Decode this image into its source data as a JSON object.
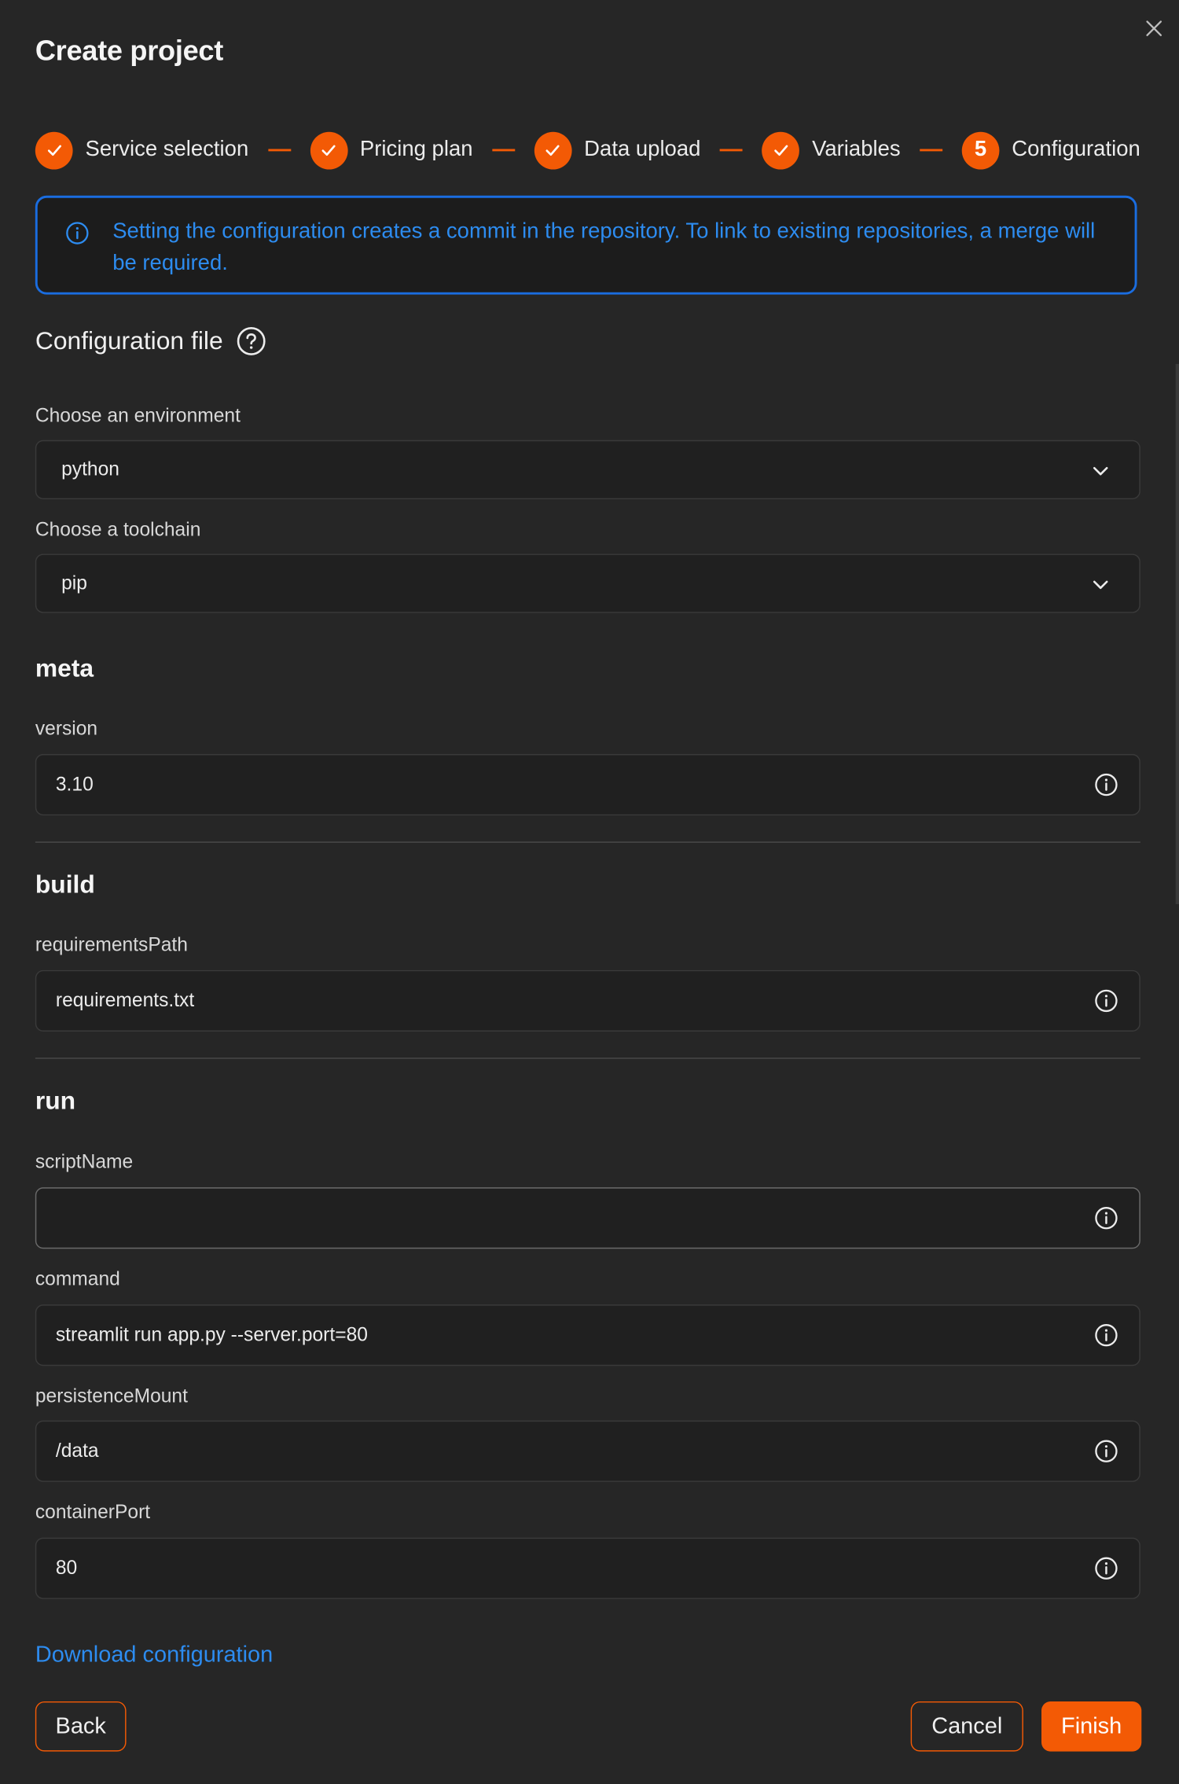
{
  "dialog": {
    "title": "Create project"
  },
  "steps": [
    {
      "label": "Service selection",
      "state": "done"
    },
    {
      "label": "Pricing plan",
      "state": "done"
    },
    {
      "label": "Data upload",
      "state": "done"
    },
    {
      "label": "Variables",
      "state": "done"
    },
    {
      "label": "Configuration",
      "state": "current",
      "number": "5"
    }
  ],
  "info": {
    "text": "Setting the configuration creates a commit in the repository. To link to existing repositories, a merge will be required."
  },
  "config_file": {
    "title": "Configuration file",
    "environment_label": "Choose an environment",
    "environment_value": "python",
    "toolchain_label": "Choose a toolchain",
    "toolchain_value": "pip"
  },
  "meta": {
    "title": "meta",
    "version_label": "version",
    "version_value": "3.10"
  },
  "build": {
    "title": "build",
    "requirements_label": "requirementsPath",
    "requirements_value": "requirements.txt"
  },
  "run": {
    "title": "run",
    "script_label": "scriptName",
    "script_value": "",
    "command_label": "command",
    "command_value": "streamlit run app.py --server.port=80",
    "persistence_label": "persistenceMount",
    "persistence_value": "/data",
    "port_label": "containerPort",
    "port_value": "80"
  },
  "footer": {
    "download_label": "Download configuration",
    "back_label": "Back",
    "cancel_label": "Cancel",
    "finish_label": "Finish"
  },
  "colors": {
    "accent": "#f35a05",
    "link": "#2d8cf0",
    "background": "#262626"
  }
}
